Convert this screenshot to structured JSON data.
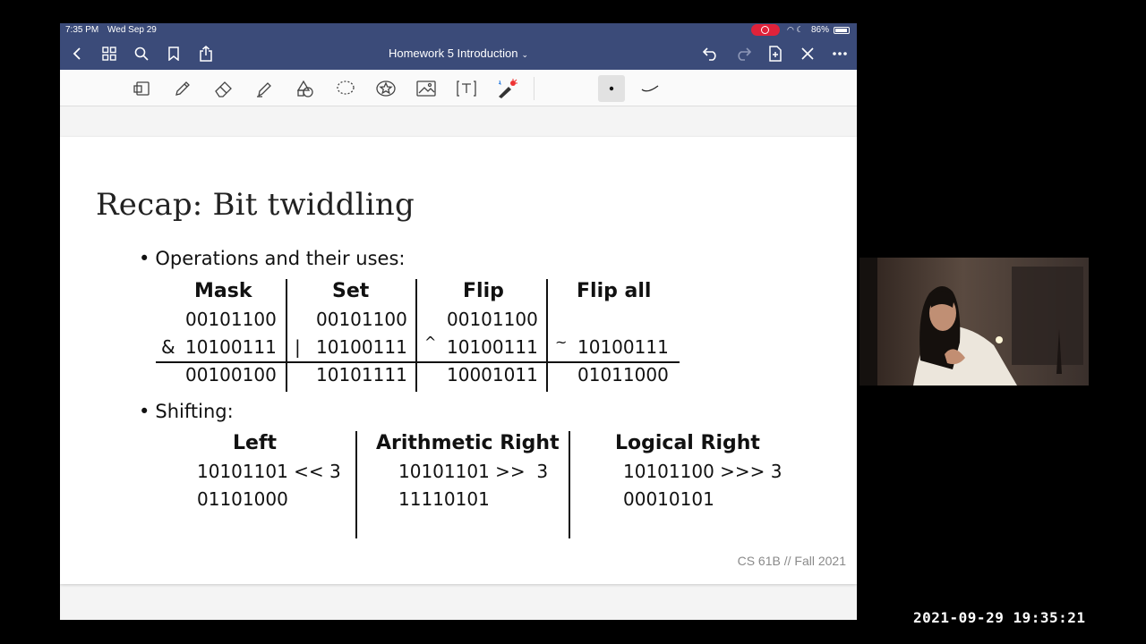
{
  "status": {
    "time": "7:35 PM",
    "date": "Wed Sep 29",
    "battery": "86%"
  },
  "navbar": {
    "title": "Homework 5 Introduction"
  },
  "colors": {
    "navbar": "#3b4b79",
    "record": "#e0223a"
  },
  "toolbar": {
    "tools": [
      "lasso-transform",
      "pen",
      "eraser",
      "highlighter",
      "shapes",
      "lasso",
      "sticker",
      "image",
      "text",
      "laser-pointer",
      "pen-size-small",
      "pen-stroke-curve"
    ]
  },
  "slide": {
    "title": "Recap: Bit twiddling",
    "bullet1": "Operations and their uses:",
    "ops": {
      "headers": [
        "Mask",
        "Set",
        "Flip",
        "Flip all"
      ],
      "row1": [
        "00101100",
        "00101100",
        "00101100"
      ],
      "operators": [
        "&",
        "|",
        "^",
        "~"
      ],
      "row2": [
        "10100111",
        "10100111",
        "10100111",
        "10100111"
      ],
      "results": [
        "00100100",
        "10101111",
        "10001011",
        "01011000"
      ]
    },
    "bullet2": "Shifting:",
    "shift": {
      "headers": [
        "Left",
        "Arithmetic Right",
        "Logical Right"
      ],
      "inputs": [
        "10101101 << 3",
        "10101101 >>  3",
        "10101100 >>> 3"
      ],
      "outputs": [
        "01101000",
        "11110101",
        "00010101"
      ]
    },
    "footer": "CS 61B // Fall 2021"
  },
  "recording": {
    "timestamp": "2021-09-29 19:35:21"
  }
}
